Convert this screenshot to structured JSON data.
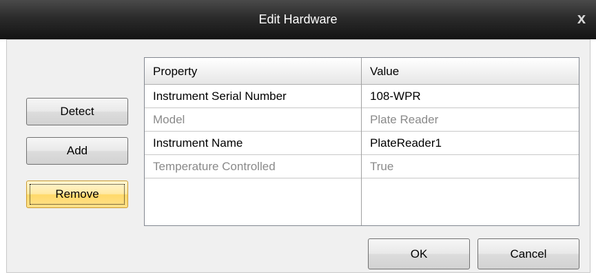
{
  "window": {
    "title": "Edit Hardware",
    "close_glyph": "x"
  },
  "buttons": {
    "detect": "Detect",
    "add": "Add",
    "remove": "Remove",
    "ok": "OK",
    "cancel": "Cancel"
  },
  "grid": {
    "columns": [
      "Property",
      "Value"
    ],
    "rows": [
      {
        "property": "Instrument Serial Number",
        "value": "108-WPR",
        "editable": true
      },
      {
        "property": "Model",
        "value": "Plate Reader",
        "editable": false
      },
      {
        "property": "Instrument Name",
        "value": "PlateReader1",
        "editable": true
      },
      {
        "property": "Temperature Controlled",
        "value": "True",
        "editable": false
      }
    ]
  },
  "colors": {
    "titlebar": "#2b2b2b",
    "focused_button": "#ffd96a",
    "disabled_text": "#8a8a8a"
  }
}
